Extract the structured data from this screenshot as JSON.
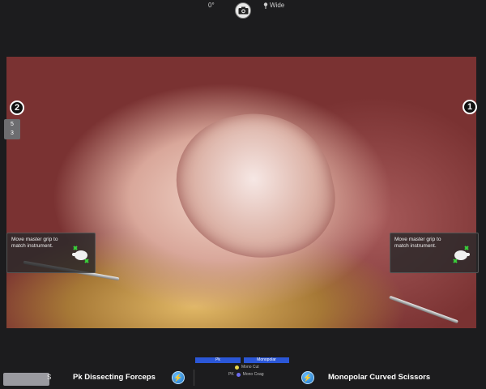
{
  "top": {
    "angle": "0°",
    "wide_label": "Wide",
    "camera_icon": "camera-icon",
    "pin_icon": "pin-icon"
  },
  "arms": {
    "left_number": "2",
    "right_number": "1",
    "aux_badge_top": "5",
    "aux_badge_bottom": "3"
  },
  "grip_panels": {
    "left_text": "Move master grip to match instrument.",
    "right_text": "Move master grip to match instrument.",
    "icon": "hand-grip-icon"
  },
  "bottom": {
    "mode_tabs": [
      "Pk",
      "Monopolar"
    ],
    "mode_rows": [
      {
        "prefix": "",
        "label": "Mono Cut",
        "color": "#e8d64a"
      },
      {
        "prefix": "PK",
        "label": "Mono Coag",
        "color": "#6d6cf0"
      }
    ],
    "left_instrument": "Pk Dissecting Forceps",
    "right_instrument": "Monopolar Curved Scissors",
    "energy_icon": "energy-bolt-icon",
    "corner_label": "S"
  },
  "colors": {
    "background": "#1c1c1e",
    "tab_blue": "#2b57d8",
    "energy_blue": "#1a6fc0"
  }
}
